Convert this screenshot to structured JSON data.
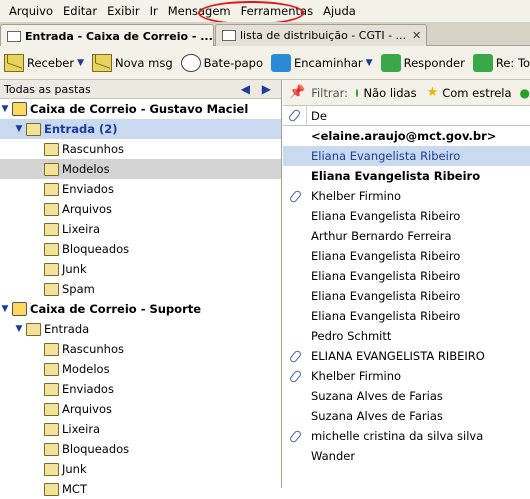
{
  "menubar": {
    "items": [
      "Arquivo",
      "Editar",
      "Exibir",
      "Ir",
      "Mensagem",
      "Ferramentas",
      "Ajuda"
    ],
    "highlight_color": "#e0191a"
  },
  "tabs": [
    {
      "label": "Entrada - Caixa de Correio - ...",
      "close": "✕",
      "active": true
    },
    {
      "label": "lista de distribuição - CGTI - ...",
      "close": "✕",
      "active": false
    }
  ],
  "toolbar": {
    "receive": "Receber",
    "new_msg": "Nova msg",
    "chat": "Bate-papo",
    "forward": "Encaminhar",
    "reply": "Responder",
    "reply_all": "Re: Todo"
  },
  "folders": {
    "header": "Todas as pastas",
    "nav_arrows": "◀ ▶",
    "accounts": [
      {
        "name": "Caixa de Correio - Gustavo Maciel",
        "inbox": "Entrada (2)",
        "subfolders": [
          "Rascunhos",
          "Modelos",
          "Enviados",
          "Arquivos",
          "Lixeira",
          "Bloqueados",
          "Junk",
          "Spam"
        ]
      },
      {
        "name": "Caixa de Correio - Suporte",
        "inbox": "Entrada",
        "subfolders": [
          "Rascunhos",
          "Modelos",
          "Enviados",
          "Arquivos",
          "Lixeira",
          "Bloqueados",
          "Junk",
          "MCT"
        ]
      }
    ]
  },
  "filter": {
    "label": "Filtrar:",
    "unread": "Não lidas",
    "starred": "Com estrela"
  },
  "messages": {
    "column_from": "De",
    "rows": [
      {
        "from": "<elaine.araujo@mct.gov.br>",
        "unread": true,
        "attachment": false,
        "selected": false
      },
      {
        "from": "Eliana Evangelista Ribeiro",
        "unread": false,
        "attachment": false,
        "selected": true
      },
      {
        "from": "Eliana Evangelista Ribeiro",
        "unread": true,
        "attachment": false,
        "selected": false
      },
      {
        "from": "Khelber Firmino",
        "unread": false,
        "attachment": true,
        "selected": false
      },
      {
        "from": "Eliana Evangelista Ribeiro",
        "unread": false,
        "attachment": false,
        "selected": false
      },
      {
        "from": "Arthur Bernardo Ferreira",
        "unread": false,
        "attachment": false,
        "selected": false
      },
      {
        "from": "Eliana Evangelista Ribeiro",
        "unread": false,
        "attachment": false,
        "selected": false
      },
      {
        "from": "Eliana Evangelista Ribeiro",
        "unread": false,
        "attachment": false,
        "selected": false
      },
      {
        "from": "Eliana Evangelista Ribeiro",
        "unread": false,
        "attachment": false,
        "selected": false
      },
      {
        "from": "Eliana Evangelista Ribeiro",
        "unread": false,
        "attachment": false,
        "selected": false
      },
      {
        "from": "Pedro Schmitt",
        "unread": false,
        "attachment": false,
        "selected": false
      },
      {
        "from": "ELIANA EVANGELISTA RIBEIRO",
        "unread": false,
        "attachment": true,
        "selected": false
      },
      {
        "from": "Khelber Firmino",
        "unread": false,
        "attachment": true,
        "selected": false
      },
      {
        "from": "Suzana Alves de Farias",
        "unread": false,
        "attachment": false,
        "selected": false
      },
      {
        "from": "Suzana Alves de Farias",
        "unread": false,
        "attachment": false,
        "selected": false
      },
      {
        "from": "michelle cristina da silva silva",
        "unread": false,
        "attachment": true,
        "selected": false
      },
      {
        "from": "Wander",
        "unread": false,
        "attachment": false,
        "selected": false
      }
    ]
  }
}
